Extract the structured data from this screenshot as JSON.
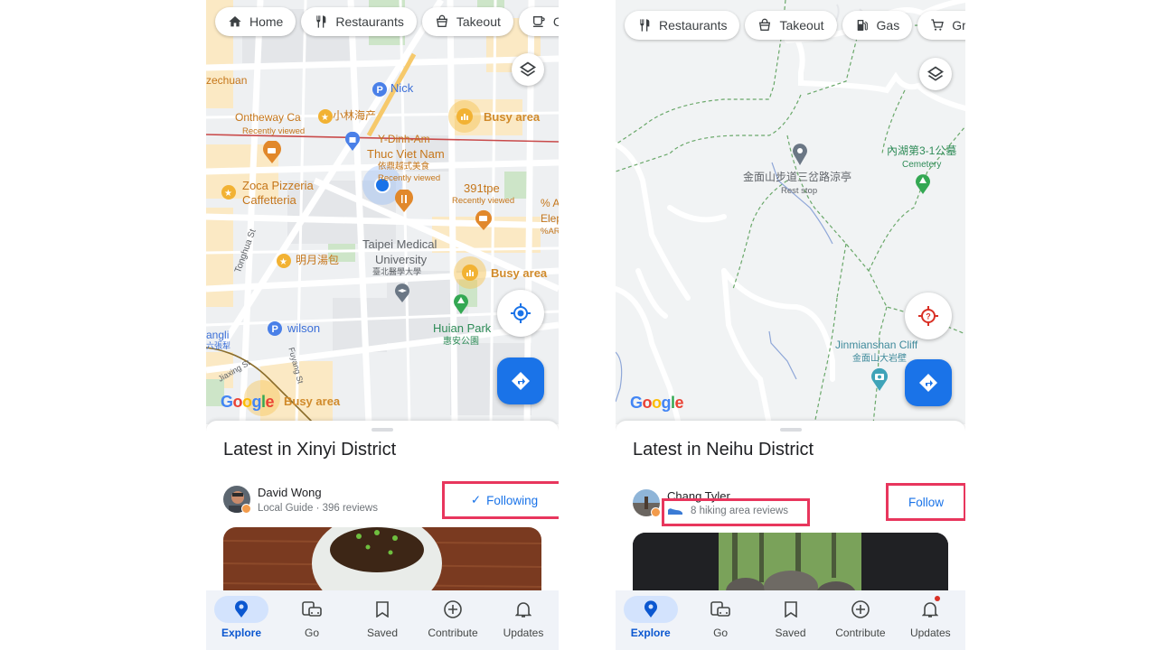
{
  "left_screen": {
    "chips": [
      {
        "icon": "home-icon",
        "label": "Home"
      },
      {
        "icon": "restaurant-icon",
        "label": "Restaurants"
      },
      {
        "icon": "takeout-icon",
        "label": "Takeout"
      },
      {
        "icon": "coffee-icon",
        "label": "Coff"
      }
    ],
    "map_labels": {
      "szechuan": "zechuan",
      "nick": "Nick",
      "ontheway": "Ontheway Ca",
      "xiaolin": "小林海产",
      "recently_viewed_1": "Recently viewed",
      "busy_area_1": "Busy area",
      "y_dinh_am": "Y-Dinh-Am",
      "thuc_viet_nam": "Thuc Viet Nam",
      "thuc_viet_nam_cn": "依鼎越式美食",
      "recently_viewed_2": "Recently viewed",
      "zoca": "Zoca Pizzeria",
      "caffetteria": "Caffetteria",
      "tpe391": "391tpe",
      "recently_viewed_3": "Recently viewed",
      "percent": "% A",
      "elep": "Elep",
      "percent_ar": "%AR",
      "tonghua": "Tonghua St",
      "mingyue": "明月湯包",
      "taipei_medical": "Taipei Medical",
      "university": "University",
      "university_cn": "臺北醫學大學",
      "busy_area_2": "Busy area",
      "huian_park": "Huian Park",
      "huian_park_cn": "惠安公園",
      "wilson": "wilson",
      "liuzhangli": "angli",
      "liuzhangli_cn": "六張犁",
      "fuyang": "Fuyang St",
      "jiaxing": "Jiaxing St",
      "busy_area_3": "Busy area"
    },
    "sheet": {
      "title": "Latest in Xinyi District",
      "user_name": "David Wong",
      "user_meta": "Local Guide · 396 reviews",
      "follow_label": "Following",
      "follow_icon": "check-icon"
    }
  },
  "right_screen": {
    "chips": [
      {
        "icon": "restaurant-icon",
        "label": "Restaurants"
      },
      {
        "icon": "takeout-icon",
        "label": "Takeout"
      },
      {
        "icon": "gas-icon",
        "label": "Gas"
      },
      {
        "icon": "grocery-icon",
        "label": "Groce"
      }
    ],
    "map_labels": {
      "cemetery_cn": "內湖第3-1公墓",
      "cemetery": "Cemetery",
      "rest_stop_cn": "金面山步道三岔路涼亭",
      "rest_stop": "Rest stop",
      "cliff": "Jinmianshan Cliff",
      "cliff_cn": "金面山大岩壁"
    },
    "sheet": {
      "title": "Latest in Neihu District",
      "user_name": "Chang Tyler",
      "user_meta": "8 hiking area reviews",
      "follow_label": "Follow"
    }
  },
  "google_logo": [
    "G",
    "o",
    "o",
    "g",
    "l",
    "e"
  ],
  "bottom_nav": [
    {
      "icon": "explore-pin-icon",
      "label": "Explore",
      "active": true
    },
    {
      "icon": "go-commute-icon",
      "label": "Go"
    },
    {
      "icon": "saved-bookmark-icon",
      "label": "Saved"
    },
    {
      "icon": "contribute-plus-icon",
      "label": "Contribute"
    },
    {
      "icon": "updates-bell-icon",
      "label": "Updates"
    }
  ],
  "colors": {
    "accent_blue": "#1a73e8",
    "highlight_red": "#e8365d",
    "busy_orange": "#d08a2a"
  }
}
